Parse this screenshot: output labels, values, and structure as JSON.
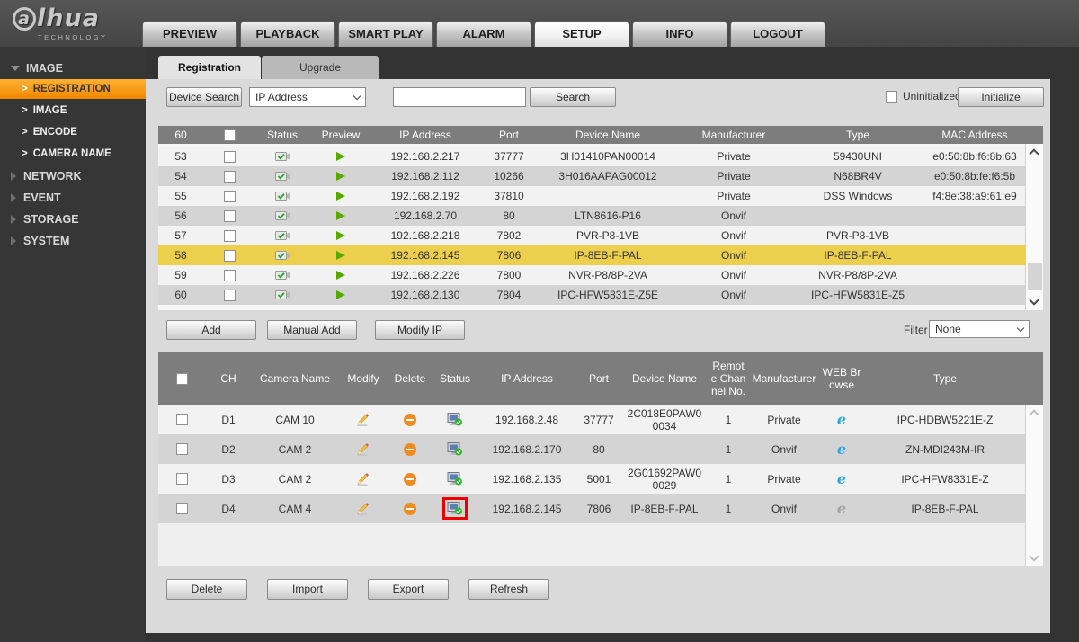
{
  "brand": {
    "logo_text": "lhua",
    "logo_a": "a",
    "logo_sub": "TECHNOLOGY"
  },
  "nav": {
    "tabs": [
      "PREVIEW",
      "PLAYBACK",
      "SMART PLAY",
      "ALARM",
      "SETUP",
      "INFO",
      "LOGOUT"
    ],
    "active_tab": "SETUP"
  },
  "sidebar": {
    "groups": [
      {
        "label": "IMAGE",
        "expanded": true,
        "items": [
          {
            "label": "REGISTRATION",
            "active": true
          },
          {
            "label": "IMAGE"
          },
          {
            "label": "ENCODE"
          },
          {
            "label": "CAMERA NAME"
          }
        ]
      },
      {
        "label": "NETWORK"
      },
      {
        "label": "EVENT"
      },
      {
        "label": "STORAGE"
      },
      {
        "label": "SYSTEM"
      }
    ]
  },
  "content": {
    "tabs": {
      "registration": "Registration",
      "upgrade": "Upgrade"
    },
    "search": {
      "device_search_label": "Device Search",
      "search_type_value": "IP Address",
      "search_input_value": "",
      "search_label": "Search",
      "uninitialized_label": "Uninitialized",
      "uninitialized_checked": false,
      "initialize_label": "Initialize"
    },
    "device_table": {
      "count": "60",
      "columns": [
        "Status",
        "Preview",
        "IP Address",
        "Port",
        "Device Name",
        "Manufacturer",
        "Type",
        "MAC Address"
      ],
      "rows": [
        {
          "no": "53",
          "ip": "192.168.2.217",
          "port": "37777",
          "name": "3H01410PAN00014",
          "manufacturer": "Private",
          "type": "59430UNI",
          "mac": "e0:50:8b:f6:8b:63"
        },
        {
          "no": "54",
          "ip": "192.168.2.112",
          "port": "10266",
          "name": "3H016AAPAG00012",
          "manufacturer": "Private",
          "type": "N68BR4V",
          "mac": "e0:50:8b:fe:f6:5b"
        },
        {
          "no": "55",
          "ip": "192.168.2.192",
          "port": "37810",
          "name": "",
          "manufacturer": "Private",
          "type": "DSS Windows",
          "mac": "f4:8e:38:a9:61:e9"
        },
        {
          "no": "56",
          "ip": "192.168.2.70",
          "port": "80",
          "name": "LTN8616-P16",
          "manufacturer": "Onvif",
          "type": "",
          "mac": ""
        },
        {
          "no": "57",
          "ip": "192.168.2.218",
          "port": "7802",
          "name": "PVR-P8-1VB",
          "manufacturer": "Onvif",
          "type": "PVR-P8-1VB",
          "mac": ""
        },
        {
          "no": "58",
          "ip": "192.168.2.145",
          "port": "7806",
          "name": "IP-8EB-F-PAL",
          "manufacturer": "Onvif",
          "type": "IP-8EB-F-PAL",
          "mac": "",
          "selected": true
        },
        {
          "no": "59",
          "ip": "192.168.2.226",
          "port": "7800",
          "name": "NVR-P8/8P-2VA",
          "manufacturer": "Onvif",
          "type": "NVR-P8/8P-2VA",
          "mac": ""
        },
        {
          "no": "60",
          "ip": "192.168.2.130",
          "port": "7804",
          "name": "IPC-HFW5831E-Z5E",
          "manufacturer": "Onvif",
          "type": "IPC-HFW5831E-Z5",
          "mac": ""
        }
      ]
    },
    "actions": {
      "add": "Add",
      "manual_add": "Manual Add",
      "modify_ip": "Modify IP",
      "filter_label": "Filter",
      "filter_value": "None"
    },
    "added_table": {
      "columns": [
        "CH",
        "Camera Name",
        "Modify",
        "Delete",
        "Status",
        "IP Address",
        "Port",
        "Device Name",
        "Remote Channel No.",
        "Manufacturer",
        "WEB Browse",
        "Type"
      ],
      "rows": [
        {
          "ch": "D1",
          "camera": "CAM 10",
          "ip": "192.168.2.48",
          "port": "37777",
          "device": "2C018E0PAW00034",
          "remote": "1",
          "manufacturer": "Private",
          "type": "IPC-HDBW5221E-Z",
          "web_active": true
        },
        {
          "ch": "D2",
          "camera": "CAM 2",
          "ip": "192.168.2.170",
          "port": "80",
          "device": "",
          "remote": "1",
          "manufacturer": "Onvif",
          "type": "ZN-MDI243M-IR",
          "web_active": true
        },
        {
          "ch": "D3",
          "camera": "CAM 2",
          "ip": "192.168.2.135",
          "port": "5001",
          "device": "2G01692PAW00029",
          "remote": "1",
          "manufacturer": "Private",
          "type": "IPC-HFW8331E-Z",
          "web_active": true
        },
        {
          "ch": "D4",
          "camera": "CAM 4",
          "ip": "192.168.2.145",
          "port": "7806",
          "device": "IP-8EB-F-PAL",
          "remote": "1",
          "manufacturer": "Onvif",
          "type": "IP-8EB-F-PAL",
          "web_active": false,
          "status_annotated": true
        }
      ]
    },
    "footer_actions": {
      "delete": "Delete",
      "import": "Import",
      "export": "Export",
      "refresh": "Refresh"
    }
  },
  "colors": {
    "accent_orange": "#f08800",
    "selected_row": "#edcf4e",
    "status_green": "#2eb52e",
    "browser_blue": "#2aa7e8",
    "annotation_red": "#ee0000"
  }
}
